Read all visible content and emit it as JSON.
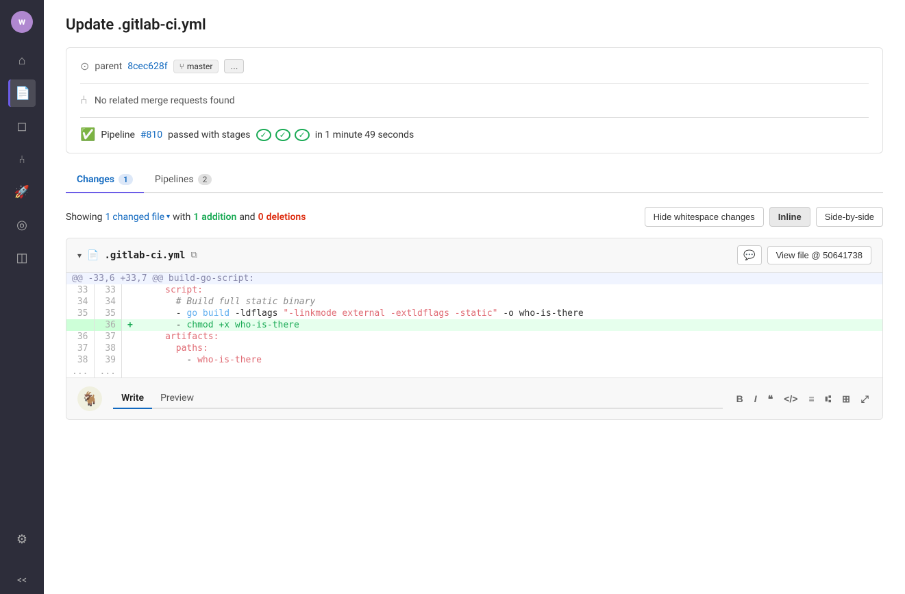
{
  "page": {
    "title": "Update .gitlab-ci.yml"
  },
  "sidebar": {
    "avatar_letter": "w",
    "items": [
      {
        "label": "Home",
        "icon": "⌂",
        "active": false
      },
      {
        "label": "Repository",
        "icon": "📄",
        "active": true
      },
      {
        "label": "Issues",
        "icon": "◻",
        "active": false
      },
      {
        "label": "Merge Requests",
        "icon": "⑃",
        "active": false
      },
      {
        "label": "CI/CD",
        "icon": "🚀",
        "active": false
      },
      {
        "label": "Analytics",
        "icon": "◎",
        "active": false
      },
      {
        "label": "Snippets",
        "icon": "◫",
        "active": false
      }
    ],
    "bottom": {
      "label": "Settings",
      "icon": "⚙"
    },
    "expand_label": "<<"
  },
  "commit": {
    "parent_label": "parent",
    "parent_hash": "8cec628f",
    "branch_icon": "⑂",
    "branch_name": "master",
    "more_label": "...",
    "no_mr_text": "No related merge requests found",
    "pipeline_text": "Pipeline",
    "pipeline_num": "#810",
    "pipeline_passed": "passed with stages",
    "pipeline_time": "in 1 minute 49 seconds"
  },
  "tabs": [
    {
      "label": "Changes",
      "count": "1",
      "active": true
    },
    {
      "label": "Pipelines",
      "count": "2",
      "active": false
    }
  ],
  "showing": {
    "prefix": "Showing",
    "changed_count": "1",
    "changed_label": "changed file",
    "with_label": "with",
    "addition_count": "1",
    "addition_label": "addition",
    "and_label": "and",
    "deletion_count": "0",
    "deletion_label": "deletions"
  },
  "diff_controls": {
    "hide_whitespace_label": "Hide whitespace changes",
    "inline_label": "Inline",
    "side_by_side_label": "Side-by-side"
  },
  "file": {
    "name": ".gitlab-ci.yml",
    "view_file_label": "View file @ 50641738"
  },
  "diff_lines": [
    {
      "type": "hunk",
      "content": "@@ -33,6 +33,7 @@ build-go-script:"
    },
    {
      "type": "normal",
      "old": "33",
      "new": "33",
      "sign": " ",
      "content": "    script:"
    },
    {
      "type": "normal",
      "old": "34",
      "new": "34",
      "sign": " ",
      "content": "      # Build full static binary"
    },
    {
      "type": "normal",
      "old": "35",
      "new": "35",
      "sign": " ",
      "content": "      - go build -ldflags \"-linkmode external -extldflags -static\" -o who-is-there"
    },
    {
      "type": "add",
      "old": "",
      "new": "36",
      "sign": "+",
      "content": "      - chmod +x who-is-there"
    },
    {
      "type": "normal",
      "old": "36",
      "new": "37",
      "sign": " ",
      "content": "    artifacts:"
    },
    {
      "type": "normal",
      "old": "37",
      "new": "38",
      "sign": " ",
      "content": "      paths:"
    },
    {
      "type": "normal",
      "old": "38",
      "new": "39",
      "sign": " ",
      "content": "        - who-is-there"
    },
    {
      "type": "hunk_end",
      "content": "..."
    }
  ],
  "comment_area": {
    "write_tab": "Write",
    "preview_tab": "Preview",
    "toolbar": {
      "bold": "B",
      "italic": "I",
      "quote": "❝",
      "code": "</>",
      "bullet": "≡",
      "numbered": "⑆",
      "link": "⊞",
      "fullscreen": "⤢"
    }
  }
}
